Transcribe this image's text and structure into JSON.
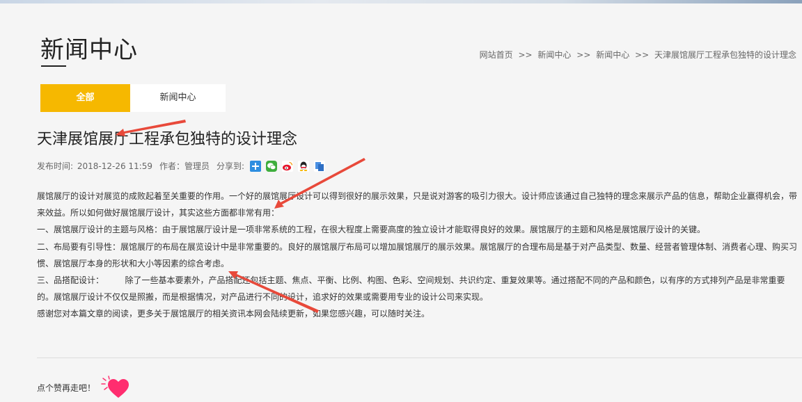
{
  "page_title": "新闻中心",
  "breadcrumb": {
    "items": [
      "网站首页",
      "新闻中心",
      "新闻中心",
      "天津展馆展厅工程承包独特的设计理念"
    ],
    "separator": ">>"
  },
  "tabs": [
    {
      "label": "全部",
      "active": true
    },
    {
      "label": "新闻中心",
      "active": false
    }
  ],
  "article": {
    "title": "天津展馆展厅工程承包独特的设计理念",
    "meta": {
      "published_label": "发布时间:",
      "published_value": "2018-12-26 11:59",
      "author_label": "作者：",
      "author_value": "管理员",
      "share_label": "分享到:"
    },
    "share_icons": [
      "qzone-icon",
      "wechat-icon",
      "weibo-icon",
      "qq-icon",
      "copy-icon"
    ],
    "paragraphs": [
      " 展馆展厅的设计对展览的成败起着至关重要的作用。一个好的展馆展厅设计可以得到很好的展示效果，只是说对游客的吸引力很大。设计师应该通过自己独特的理念来展示产品的信息，帮助企业赢得机会，带来效益。所以如何做好展馆展厅设计，其实这些方面都非常有用：",
      "一、展馆展厅设计的主题与风格：由于展馆展厅设计是一项非常系统的工程，在很大程度上需要高度的独立设计才能取得良好的效果。展馆展厅的主题和风格是展馆展厅设计的关键。",
      "二、布局要有引导性：展馆展厅的布局在展览设计中是非常重要的。良好的展馆展厅布局可以增加展馆展厅的展示效果。展馆展厅的合理布局是基于对产品类型、数量、经营者管理体制、消费者心理、购买习惯、展馆展厅本身的形状和大小等因素的综合考虑。",
      "三、品搭配设计：        除了一些基本要素外，产品搭配还包括主题、焦点、平衡、比例、构图、色彩、空间规划、共识约定、重复效果等。通过搭配不同的产品和颜色，以有序的方式排列产品是非常重要的。展馆展厅设计不仅仅是照搬，而是根据情况，对产品进行不同的设计，追求好的效果或需要用专业的设计公司来实现。",
      "感谢您对本篇文章的阅读，更多关于展馆展厅的相关资讯本网会陆续更新，如果您感兴趣，可以随时关注。"
    ]
  },
  "like": {
    "text": "点个赞再走吧！"
  },
  "colors": {
    "accent": "#f6b800",
    "annotation_arrow": "#e8493a",
    "heart": "#ff2d6f"
  }
}
